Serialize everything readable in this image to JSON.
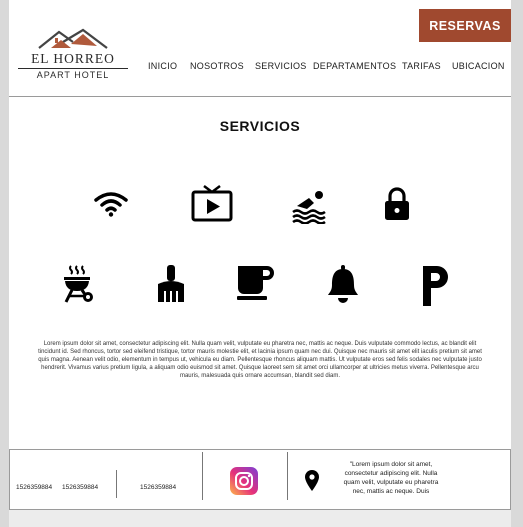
{
  "brand": {
    "name": "EL HORREO",
    "subtitle": "APART HOTEL"
  },
  "header": {
    "reserve_label": "RESERVAS",
    "nav": [
      {
        "label": "INICIO"
      },
      {
        "label": "NOSOTROS"
      },
      {
        "label": "SERVICIOS"
      },
      {
        "label": "DEPARTAMENTOS"
      },
      {
        "label": "TARIFAS"
      },
      {
        "label": "UBICACION"
      }
    ]
  },
  "services": {
    "title": "SERVICIOS",
    "icons": [
      "wifi-icon",
      "tv-icon",
      "pool-icon",
      "lock-icon",
      "grill-icon",
      "cleaning-icon",
      "coffee-icon",
      "bell-icon",
      "parking-icon"
    ],
    "description": "Lorem ipsum dolor sit amet, consectetur adipiscing elit. Nulla quam velit, vulputate eu pharetra nec, mattis ac neque. Duis vulputate commodo lectus, ac blandit elit tincidunt id. Sed rhoncus, tortor sed eleifend tristique, tortor mauris molestie elit, et lacinia ipsum quam nec dui. Quisque nec mauris sit amet elit iaculis pretium sit amet quis magna. Aenean velit odio, elementum in tempus ut, vehicula eu diam. Pellentesque rhoncus aliquam mattis. Ut vulputate eros sed felis sodales nec vulputate justo hendrerit. Vivamus varius pretium ligula, a aliquam odio euismod sit amet. Quisque laoreet sem sit amet orci ullamcorper at ultricies metus viverra. Pellentesque arcu mauris, malesuada quis ornare accumsan, blandit sed diam."
  },
  "footer": {
    "phones": [
      "1526359884",
      "1526359884",
      "1526359884"
    ],
    "address_text": "\"Lorem ipsum dolor sit amet, consectetur adipiscing elit. Nulla quam velit, vulputate eu pharetra nec, mattis ac neque. Duis",
    "social_icon": "instagram-icon",
    "location_icon": "map-pin-icon"
  },
  "colors": {
    "accent": "#a0492f",
    "roof": "#b05a3c",
    "text": "#111111"
  }
}
